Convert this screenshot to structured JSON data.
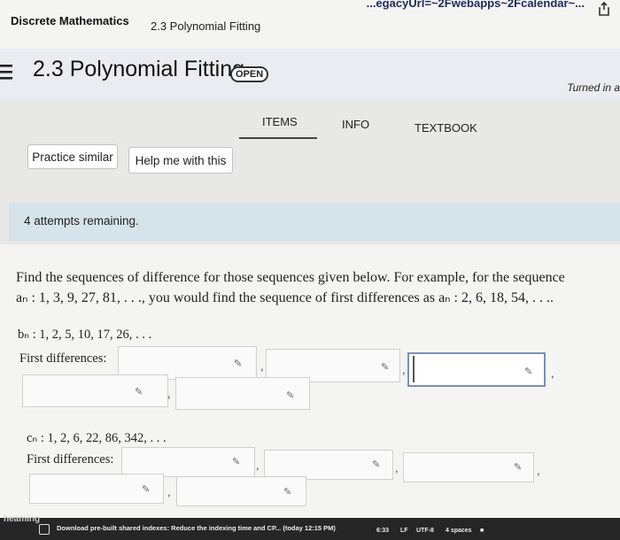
{
  "browser": {
    "url_fragment": "...egacyUrl=~2Fwebapps~2Fcalendar~..."
  },
  "breadcrumb": {
    "course": "Discrete Mathematics",
    "section": "2.3 Polynomial Fitting"
  },
  "header": {
    "title": "2.3 Polynomial Fitting",
    "badge": "OPEN",
    "turned_in": "Turned in a"
  },
  "tabs": [
    {
      "label": "ITEMS",
      "active": true
    },
    {
      "label": "INFO"
    },
    {
      "label": "TEXTBOOK"
    }
  ],
  "buttons": {
    "practice": "Practice similar",
    "help": "Help me with this"
  },
  "attempts": "4 attempts remaining.",
  "question": {
    "line1": "Find the sequences of difference for those sequences given below. For example, for the sequence",
    "line2": "aₙ : 1, 3, 9, 27, 81, . . ., you would find the sequence of first differences as aₙ : 2, 6, 18, 54, . . ..",
    "seq_b": "bₙ : 1, 2, 5, 10, 17, 26, . . .",
    "seq_c": "cₙ : 1, 2, 6, 22, 86, 342, . . .",
    "first_diff_label": "First differences:",
    "comma": ","
  },
  "editor": {
    "heaming": "heaming",
    "notice": "Download pre-built shared indexes: Reduce the indexing time and CP... (today 12:15 PM)",
    "position": "6:33",
    "line_ending": "LF",
    "encoding": "UTF-8",
    "indent": "4 spaces"
  },
  "colors": {
    "accent_border": "#7a8fb8",
    "attempts_bg": "#d7e3ea",
    "header_bg": "#e9ecf0"
  }
}
